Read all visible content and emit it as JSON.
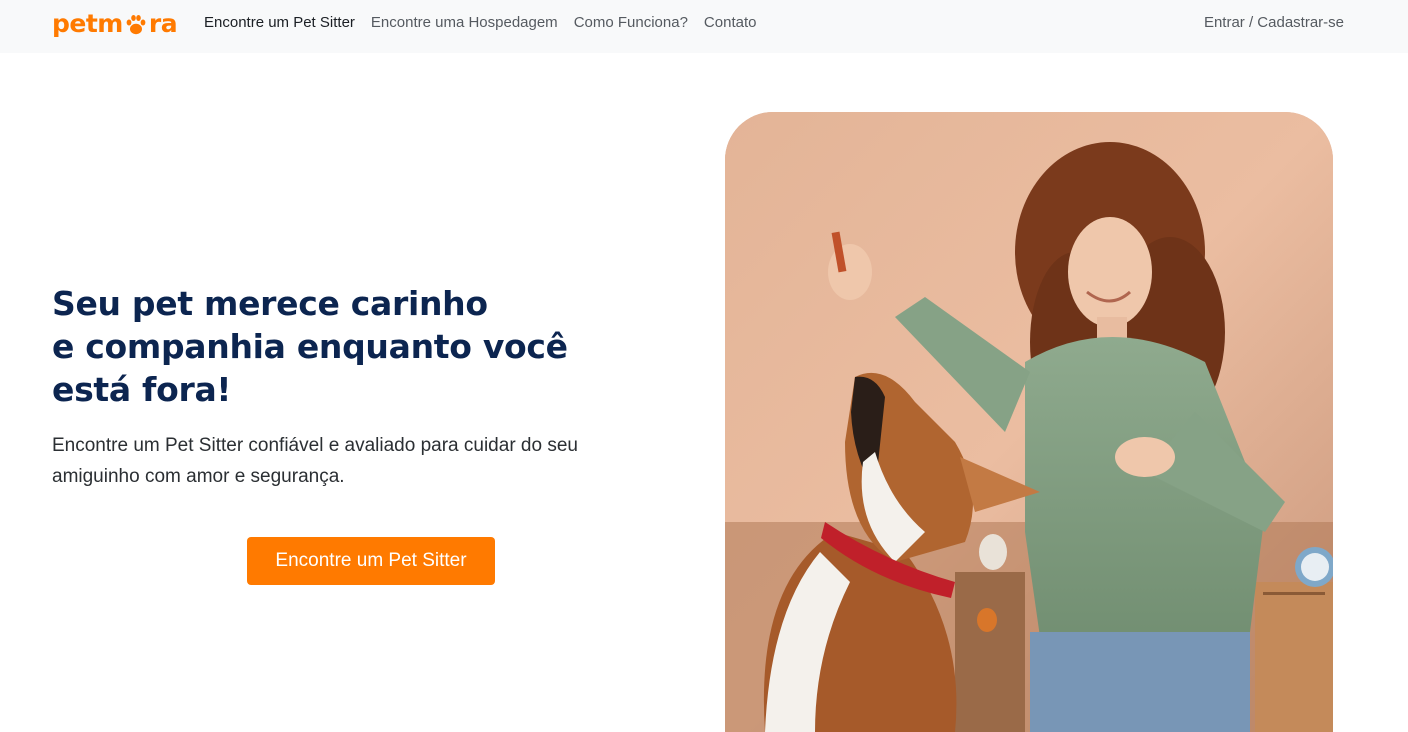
{
  "brand": {
    "name_part1": "petm",
    "name_part2": "ra",
    "color": "#ff7a00"
  },
  "nav": {
    "links": [
      {
        "label": "Encontre um Pet Sitter",
        "active": true
      },
      {
        "label": "Encontre uma Hospedagem",
        "active": false
      },
      {
        "label": "Como Funciona?",
        "active": false
      },
      {
        "label": "Contato",
        "active": false
      }
    ],
    "auth_label": "Entrar / Cadastrar-se"
  },
  "hero": {
    "title_lines": [
      "Seu pet merece carinho",
      "e companhia enquanto você",
      "está fora!"
    ],
    "subtitle_lines": [
      "Encontre um Pet Sitter confiável e avaliado para cuidar do seu",
      "amiguinho com amor e segurança."
    ],
    "cta_label": "Encontre um Pet Sitter"
  },
  "colors": {
    "accent": "#ff7a00",
    "heading": "#0c2550",
    "navbar_bg": "#f8f9fa"
  },
  "icons": {
    "logo_paw": "paw-icon"
  }
}
